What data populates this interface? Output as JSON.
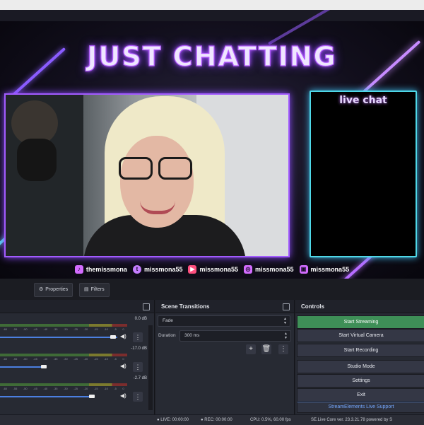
{
  "preview": {
    "title": "JUST CHATTING",
    "chat_title": "live chat",
    "socials": [
      {
        "icon": "tiktok-icon",
        "handle": "themissmona"
      },
      {
        "icon": "twitter-icon",
        "handle": "missmona55"
      },
      {
        "icon": "youtube-icon",
        "handle": "missmona55"
      },
      {
        "icon": "instagram-icon",
        "handle": "missmona55"
      },
      {
        "icon": "twitch-icon",
        "handle": "missmona55"
      }
    ],
    "accent": "#a25bff",
    "chat_border": "#4fd8e8"
  },
  "source_toolbar": {
    "properties_label": "Properties",
    "filters_label": "Filters"
  },
  "mixer": {
    "channels": [
      {
        "db": "0.0 dB"
      },
      {
        "db": "-17.0 dB"
      },
      {
        "db": "-2.7 dB"
      }
    ],
    "ticks": [
      "-60",
      "-55",
      "-50",
      "-45",
      "-40",
      "-35",
      "-30",
      "-25",
      "-20",
      "-15",
      "-10",
      "-5",
      "0"
    ]
  },
  "transitions": {
    "title": "Scene Transitions",
    "selected": "Fade",
    "duration_label": "Duration",
    "duration_value": "300 ms",
    "add_label": "+",
    "trash_label": "🗑",
    "more_label": "⋮"
  },
  "controls": {
    "title": "Controls",
    "start_streaming": "Start Streaming",
    "start_virtual_camera": "Start Virtual Camera",
    "start_recording": "Start Recording",
    "studio_mode": "Studio Mode",
    "settings": "Settings",
    "exit": "Exit",
    "streamelements": "StreamElements Live Support",
    "primary_color": "#3e8f57"
  },
  "status": {
    "live": "LIVE: 00:00:00",
    "rec": "REC: 00:00:00",
    "cpu": "CPU: 0.5%, 60.00 fps",
    "version": "SE.Live Core ver. 23.3.21.78 powered by S"
  }
}
